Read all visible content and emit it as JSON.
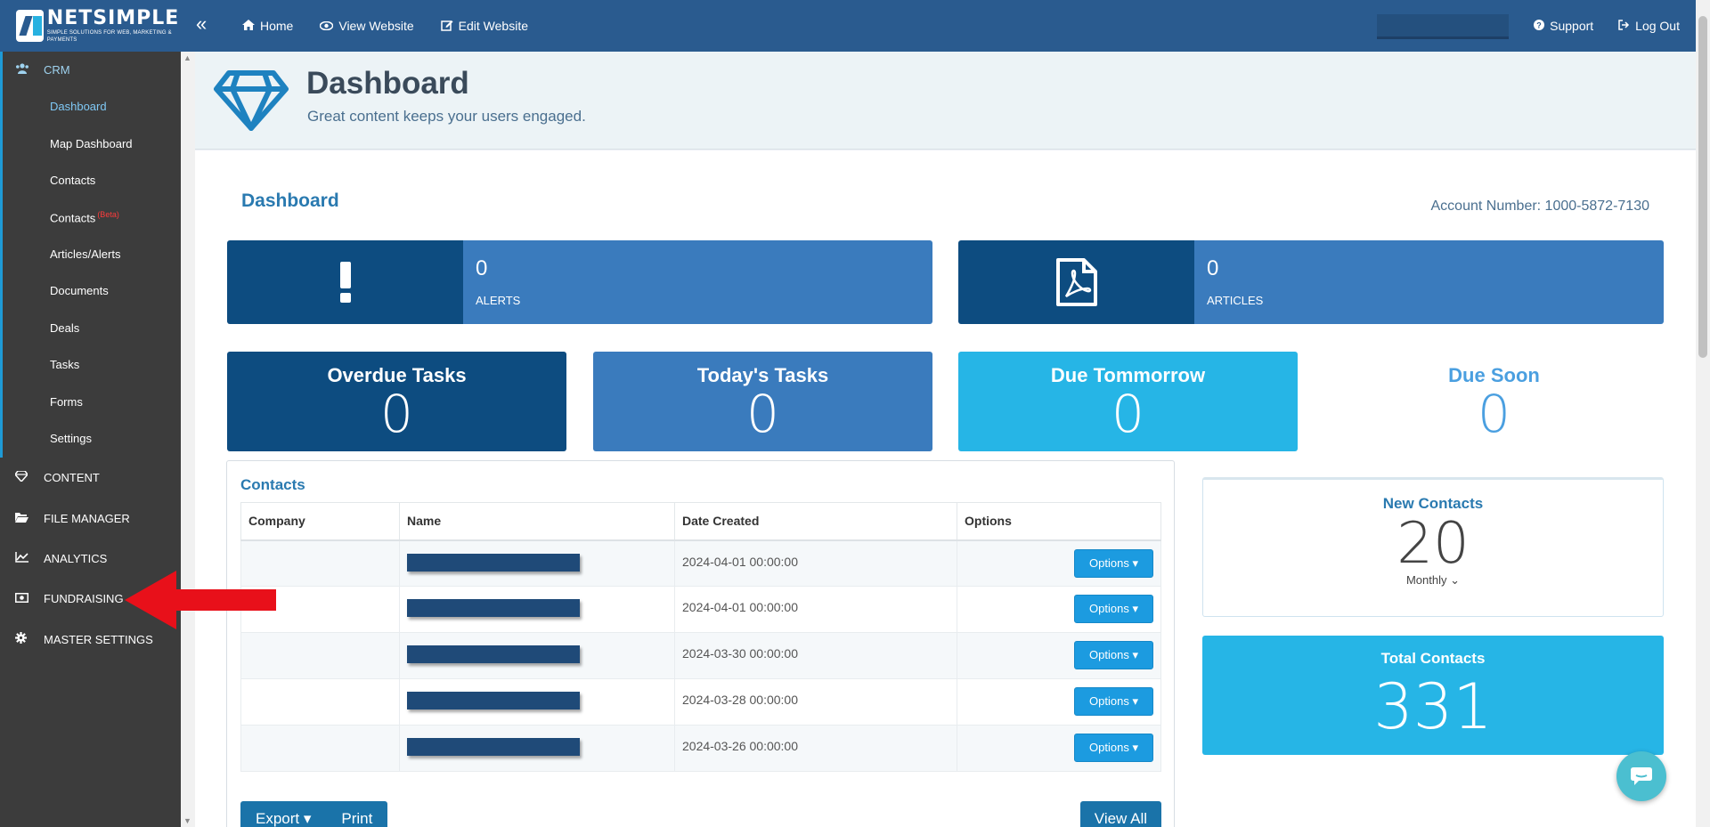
{
  "brand": {
    "name": "NETSIMPLE",
    "tagline": "SIMPLE SOLUTIONS FOR WEB, MARKETING & PAYMENTS"
  },
  "topnav": {
    "home": "Home",
    "view_website": "View Website",
    "edit_website": "Edit Website",
    "support": "Support",
    "logout": "Log Out"
  },
  "sidebar": {
    "crm_label": "CRM",
    "crm_items": [
      {
        "label": "Dashboard"
      },
      {
        "label": "Map Dashboard"
      },
      {
        "label": "Contacts"
      },
      {
        "label": "Contacts",
        "badge": "(Beta)"
      },
      {
        "label": "Articles/Alerts"
      },
      {
        "label": "Documents"
      },
      {
        "label": "Deals"
      },
      {
        "label": "Tasks"
      },
      {
        "label": "Forms"
      },
      {
        "label": "Settings"
      }
    ],
    "sections": [
      {
        "label": "CONTENT",
        "icon": "diamond-icon"
      },
      {
        "label": "FILE MANAGER",
        "icon": "folder-open-icon"
      },
      {
        "label": "ANALYTICS",
        "icon": "line-chart-icon"
      },
      {
        "label": "FUNDRAISING",
        "icon": "money-icon"
      },
      {
        "label": "MASTER SETTINGS",
        "icon": "gear-icon"
      }
    ]
  },
  "header": {
    "title": "Dashboard",
    "subtitle": "Great content keeps your users engaged."
  },
  "dashboard": {
    "title": "Dashboard",
    "account": "Account Number: 1000-5872-7130",
    "alerts": {
      "value": "0",
      "label": "ALERTS"
    },
    "articles": {
      "value": "0",
      "label": "ARTICLES"
    },
    "tasks": [
      {
        "title": "Overdue Tasks",
        "value": "0"
      },
      {
        "title": "Today's Tasks",
        "value": "0"
      },
      {
        "title": "Due Tommorrow",
        "value": "0"
      },
      {
        "title": "Due Soon",
        "value": "0"
      }
    ]
  },
  "contacts": {
    "title": "Contacts",
    "columns": [
      "Company",
      "Name",
      "Date Created",
      "Options"
    ],
    "rows": [
      {
        "company": "",
        "date": "2024-04-01 00:00:00",
        "options": "Options"
      },
      {
        "company": "",
        "date": "2024-04-01 00:00:00",
        "options": "Options"
      },
      {
        "company": "",
        "date": "2024-03-30 00:00:00",
        "options": "Options"
      },
      {
        "company": "",
        "date": "2024-03-28 00:00:00",
        "options": "Options"
      },
      {
        "company": "",
        "date": "2024-03-26 00:00:00",
        "options": "Options"
      }
    ],
    "export": "Export",
    "print": "Print",
    "view_all": "View All"
  },
  "new_contacts": {
    "title": "New Contacts",
    "value": "20",
    "period": "Monthly"
  },
  "total_contacts": {
    "title": "Total Contacts",
    "value": "331"
  },
  "colors": {
    "topbar": "#2a5b8f",
    "sidebar": "#3c3c3c",
    "dark_blue": "#0d4c80",
    "mid_blue": "#3a7bbd",
    "light_blue": "#26b5e6",
    "arrow_red": "#e8101a"
  }
}
